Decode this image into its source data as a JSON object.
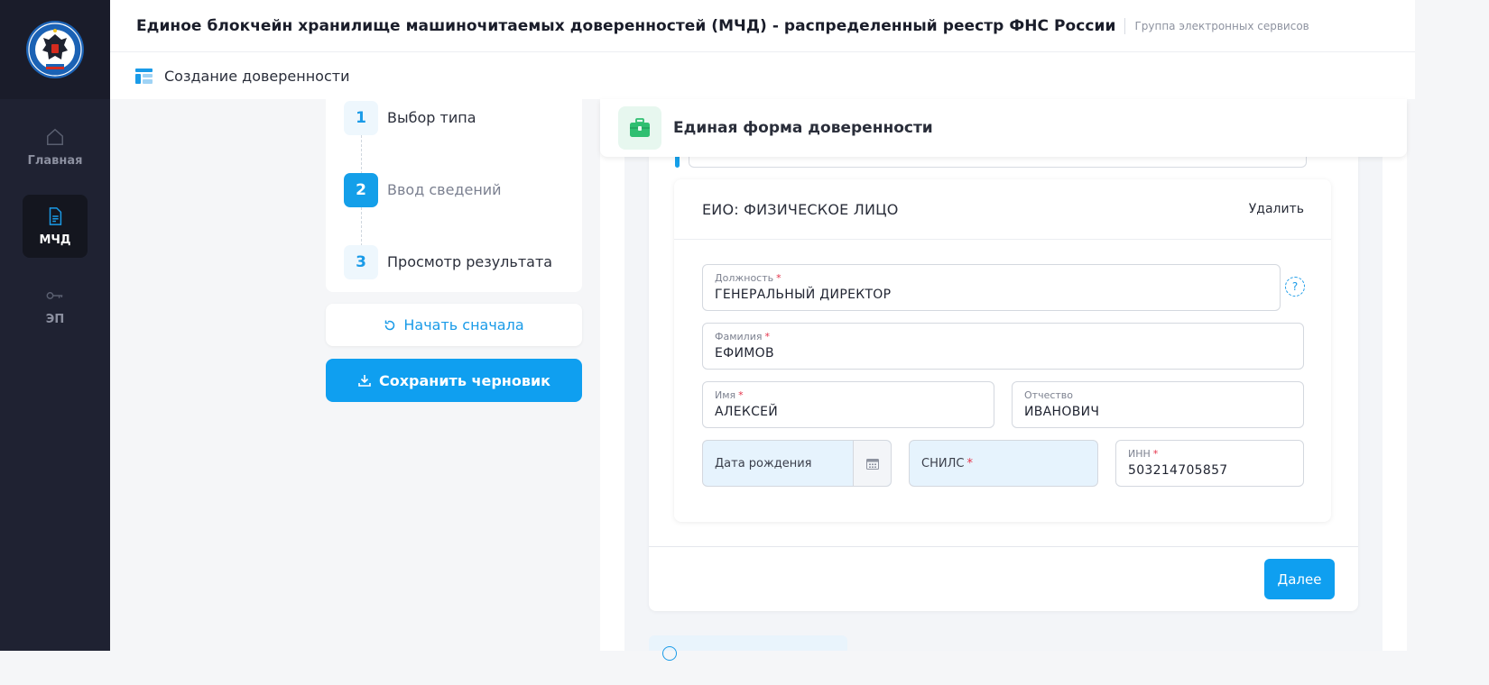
{
  "colors": {
    "sidebar_bg": "#1f2232",
    "accent": "#0f9ff0",
    "required": "#e5334a",
    "field_highlight": "#e6f3fd"
  },
  "sidebar": {
    "logo_icon": "fns-emblem-icon",
    "items": [
      {
        "label": "Главная",
        "icon": "home-icon",
        "active": false
      },
      {
        "label": "МЧД",
        "icon": "document-icon",
        "active": true
      },
      {
        "label": "ЭП",
        "icon": "key-icon",
        "active": false
      }
    ]
  },
  "header": {
    "title": "Единое блокчейн хранилище машиночитаемых доверенностей (МЧД) - распределенный реестр ФНС России",
    "subtitle": "Группа электронных сервисов"
  },
  "subheader": {
    "icon": "layout-icon",
    "title": "Создание доверенности"
  },
  "steps": [
    {
      "number": "1",
      "label": "Выбор типа",
      "active": false
    },
    {
      "number": "2",
      "label": "Ввод сведений",
      "active": true
    },
    {
      "number": "3",
      "label": "Просмотр результата",
      "active": false
    }
  ],
  "buttons": {
    "restart": "Начать сначала",
    "save_draft": "Сохранить черновик",
    "next": "Далее"
  },
  "form": {
    "title": "Единая форма доверенности",
    "icon": "briefcase-icon"
  },
  "person": {
    "title": "ЕИО: ФИЗИЧЕСКОЕ ЛИЦО",
    "delete": "Удалить",
    "help": "?",
    "fields": {
      "position": {
        "label": "Должность",
        "required": "*",
        "value": "ГЕНЕРАЛЬНЫЙ ДИРЕКТОР"
      },
      "last_name": {
        "label": "Фамилия",
        "required": "*",
        "value": "ЕФИМОВ"
      },
      "first_name": {
        "label": "Имя",
        "required": "*",
        "value": "АЛЕКСЕЙ"
      },
      "patronymic": {
        "label": "Отчество",
        "value": "ИВАНОВИЧ"
      },
      "birth_date": {
        "label": "Дата рождения",
        "icon": "calendar-icon"
      },
      "snils": {
        "label": "СНИЛС",
        "required": "*"
      },
      "inn": {
        "label": "ИНН",
        "required": "*",
        "value": "503214705857"
      }
    }
  }
}
